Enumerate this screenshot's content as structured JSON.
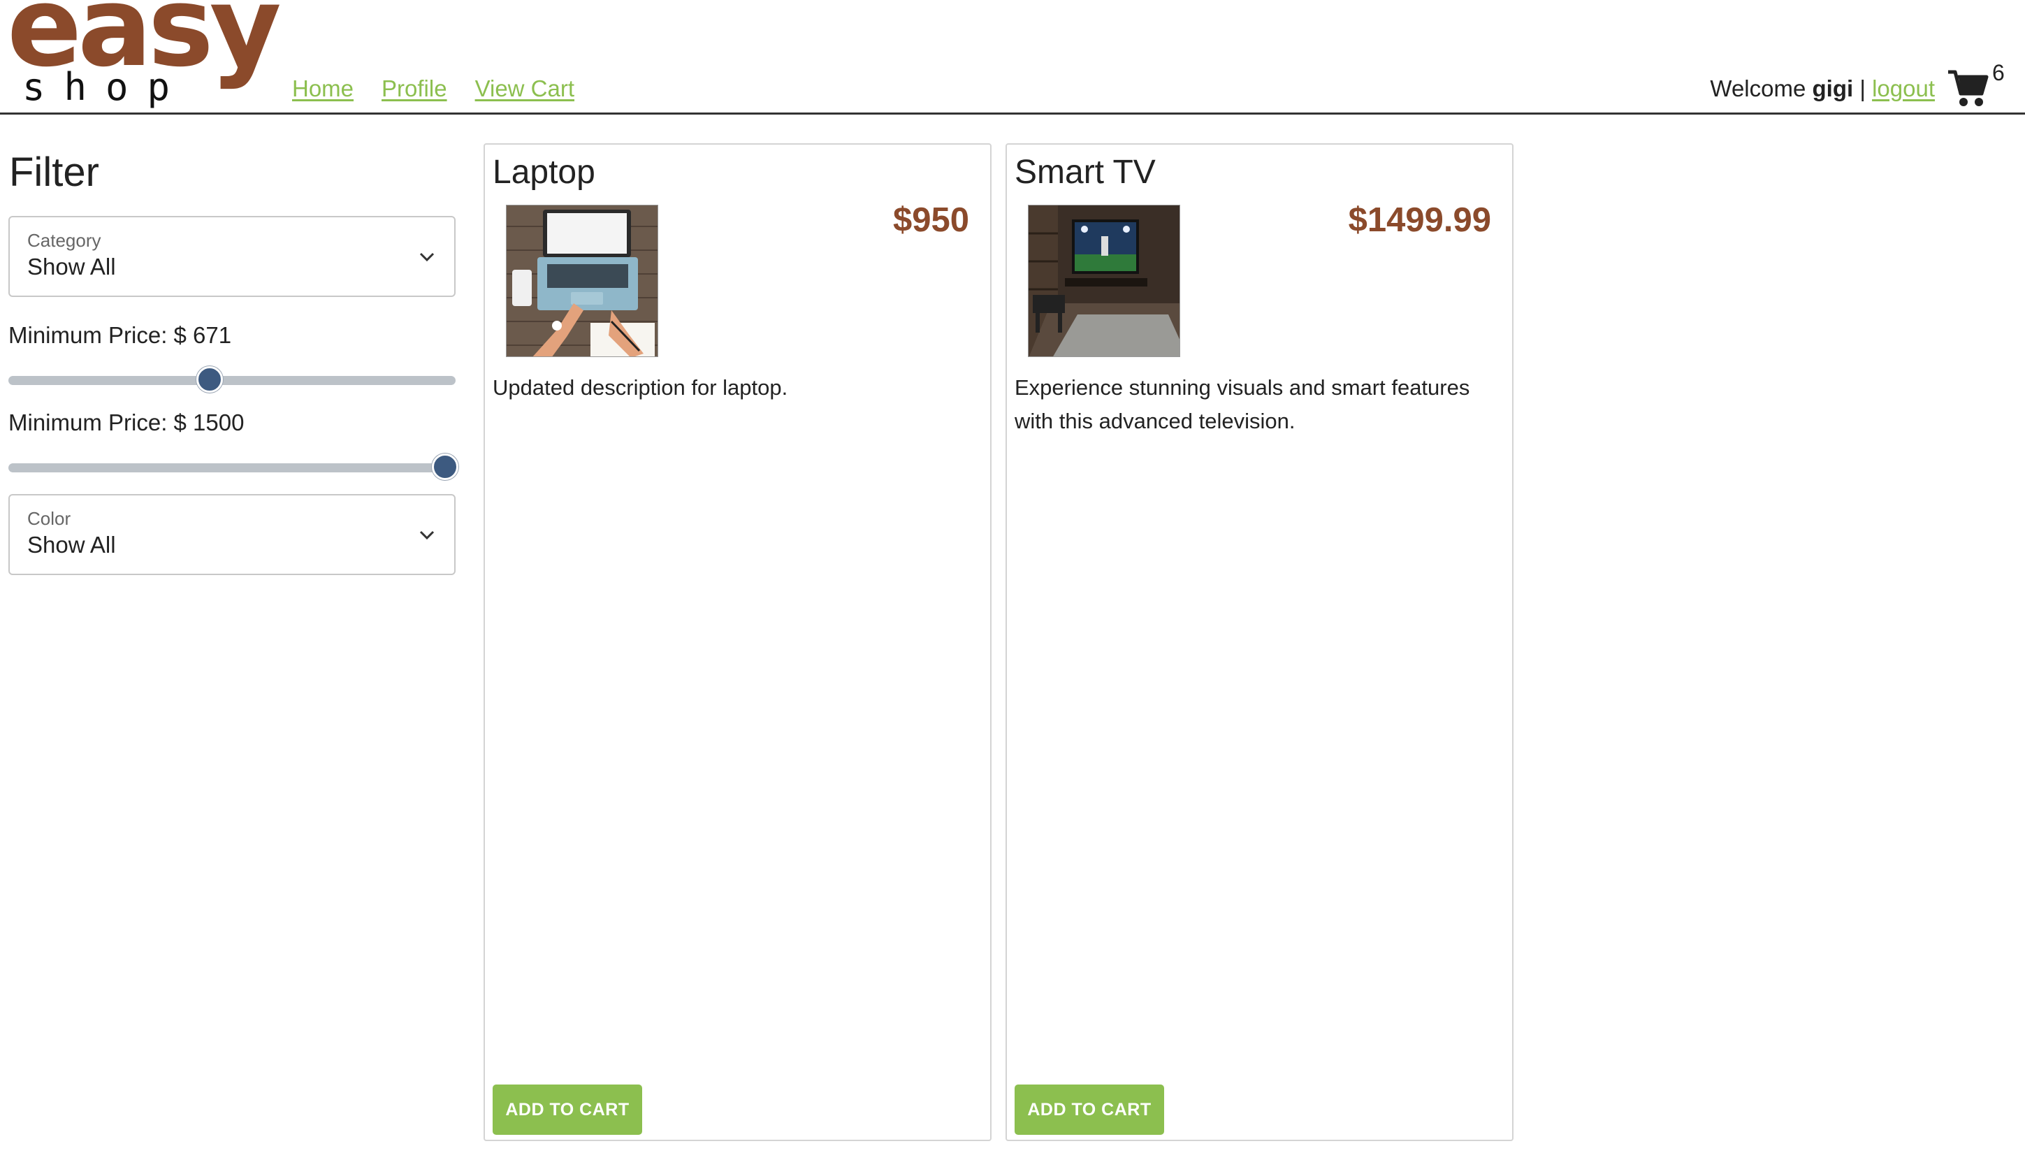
{
  "header": {
    "logo_top": "easy",
    "logo_bottom": "shop",
    "nav": [
      "Home",
      "Profile",
      "View Cart"
    ],
    "welcome_prefix": "Welcome ",
    "username": "gigi",
    "separator": " | ",
    "logout_label": "logout",
    "cart_icon": "shopping-cart-icon",
    "cart_count": "6"
  },
  "filter": {
    "title": "Filter",
    "category": {
      "label": "Category",
      "value": "Show All"
    },
    "min_price": {
      "label": "Minimum Price: $ 671",
      "value": 671,
      "slider_fraction": 0.45
    },
    "max_price": {
      "label": "Minimum Price: $ 1500",
      "value": 1500,
      "slider_fraction": 0.98
    },
    "color": {
      "label": "Color",
      "value": "Show All"
    }
  },
  "products": [
    {
      "name": "Laptop",
      "price": "$950",
      "description": "Updated description for laptop.",
      "button_label": "ADD TO CART"
    },
    {
      "name": "Smart TV",
      "price": "$1499.99",
      "description": "Experience stunning visuals and smart features with this advanced television.",
      "button_label": "ADD TO CART"
    }
  ],
  "colors": {
    "accent_green": "#8cbf4f",
    "brand_brown": "#8b4a2b",
    "slider_thumb": "#3d5a80"
  }
}
